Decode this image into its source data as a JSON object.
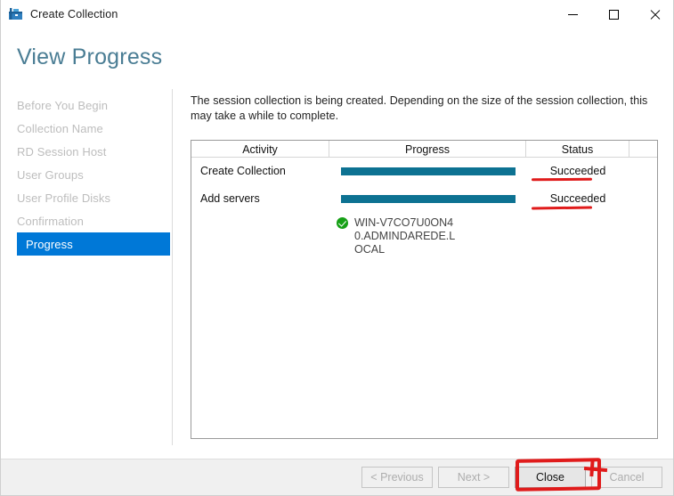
{
  "window": {
    "title": "Create Collection",
    "icon": "collection-toolbox-icon",
    "minimize_label": "–",
    "maximize_label": "□",
    "close_label": "✕"
  },
  "page": {
    "heading": "View Progress"
  },
  "sidebar": {
    "items": [
      {
        "label": "Before You Begin",
        "active": false
      },
      {
        "label": "Collection Name",
        "active": false
      },
      {
        "label": "RD Session Host",
        "active": false
      },
      {
        "label": "User Groups",
        "active": false
      },
      {
        "label": "User Profile Disks",
        "active": false
      },
      {
        "label": "Confirmation",
        "active": false
      },
      {
        "label": "Progress",
        "active": true
      }
    ],
    "active_color": "#0078d7"
  },
  "main": {
    "intro": "The session collection is being created. Depending on the size of the session collection, this may take a while to complete.",
    "table": {
      "columns": [
        "Activity",
        "Progress",
        "Status"
      ],
      "rows": [
        {
          "activity": "Create Collection",
          "progress_percent": 100,
          "status": "Succeeded"
        },
        {
          "activity": "Add servers",
          "progress_percent": 100,
          "status": "Succeeded"
        }
      ],
      "server_result": {
        "icon": "success-check-icon",
        "name": "WIN-V7CO7U0ON40.ADMINDAREDE.LOCAL"
      },
      "progress_bar_color": "#0d7292",
      "success_icon_color": "#16a016"
    }
  },
  "footer": {
    "buttons": [
      {
        "label": "< Previous",
        "enabled": false
      },
      {
        "label": "Next >",
        "enabled": false
      },
      {
        "label": "Close",
        "enabled": true
      },
      {
        "label": "Cancel",
        "enabled": false
      }
    ]
  },
  "annotations": {
    "color": "#e01b1b",
    "marks": [
      "underline-status-row-1",
      "underline-status-row-2",
      "box-around-close-button"
    ]
  }
}
